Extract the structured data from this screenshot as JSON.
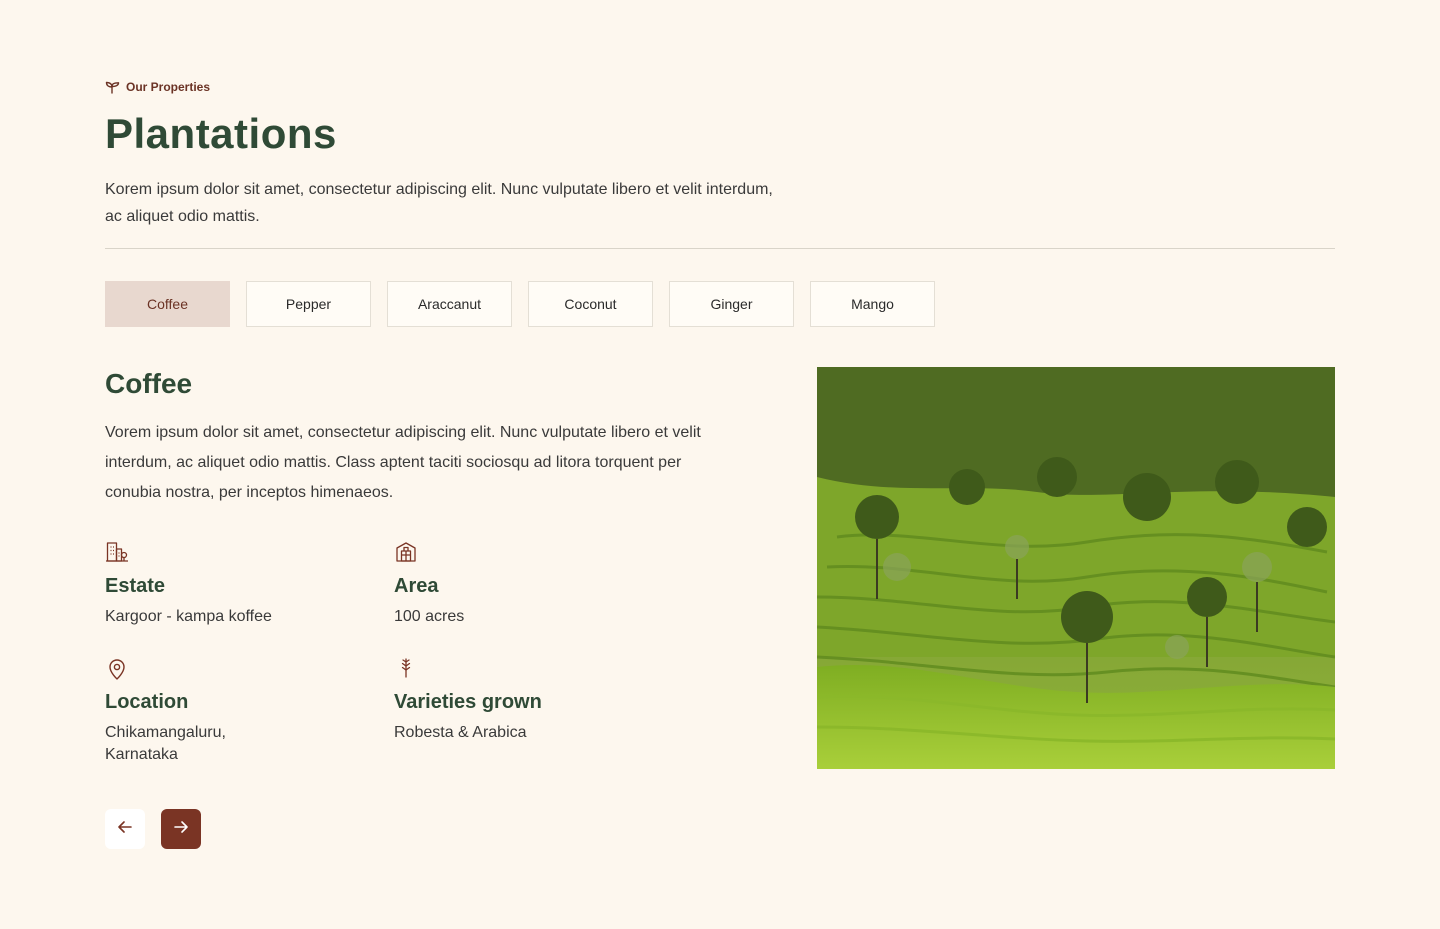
{
  "header": {
    "eyebrow": "Our Properties",
    "eyebrow_icon": "sprout-icon",
    "title": "Plantations",
    "intro": "Korem ipsum dolor sit amet, consectetur adipiscing elit. Nunc vulputate libero et velit interdum, ac aliquet odio mattis."
  },
  "tabs": [
    {
      "label": "Coffee",
      "active": true
    },
    {
      "label": "Pepper",
      "active": false
    },
    {
      "label": "Araccanut",
      "active": false
    },
    {
      "label": "Coconut",
      "active": false
    },
    {
      "label": "Ginger",
      "active": false
    },
    {
      "label": "Mango",
      "active": false
    }
  ],
  "detail": {
    "title": "Coffee",
    "description": "Vorem ipsum dolor sit amet, consectetur adipiscing elit. Nunc vulputate libero et velit interdum, ac aliquet odio mattis. Class aptent taciti sociosqu ad litora torquent per conubia nostra, per inceptos himenaeos.",
    "facts": {
      "estate": {
        "label": "Estate",
        "value": "Kargoor - kampa koffee",
        "icon": "building-icon"
      },
      "area": {
        "label": "Area",
        "value": "100 acres",
        "icon": "warehouse-icon"
      },
      "location": {
        "label": "Location",
        "value_line1": "Chikamangaluru,",
        "value_line2": "Karnataka",
        "icon": "map-pin-icon"
      },
      "varieties": {
        "label": "Varieties grown",
        "value": "Robesta & Arabica",
        "icon": "wheat-icon"
      }
    },
    "image": "coffee-plantation-hillside-photo"
  },
  "nav": {
    "prev_icon": "arrow-left-icon",
    "next_icon": "arrow-right-icon"
  },
  "colors": {
    "background": "#fdf7ee",
    "heading_green": "#2f4a36",
    "accent_brown": "#7a3424",
    "active_tab_bg": "#e8d8cf"
  }
}
